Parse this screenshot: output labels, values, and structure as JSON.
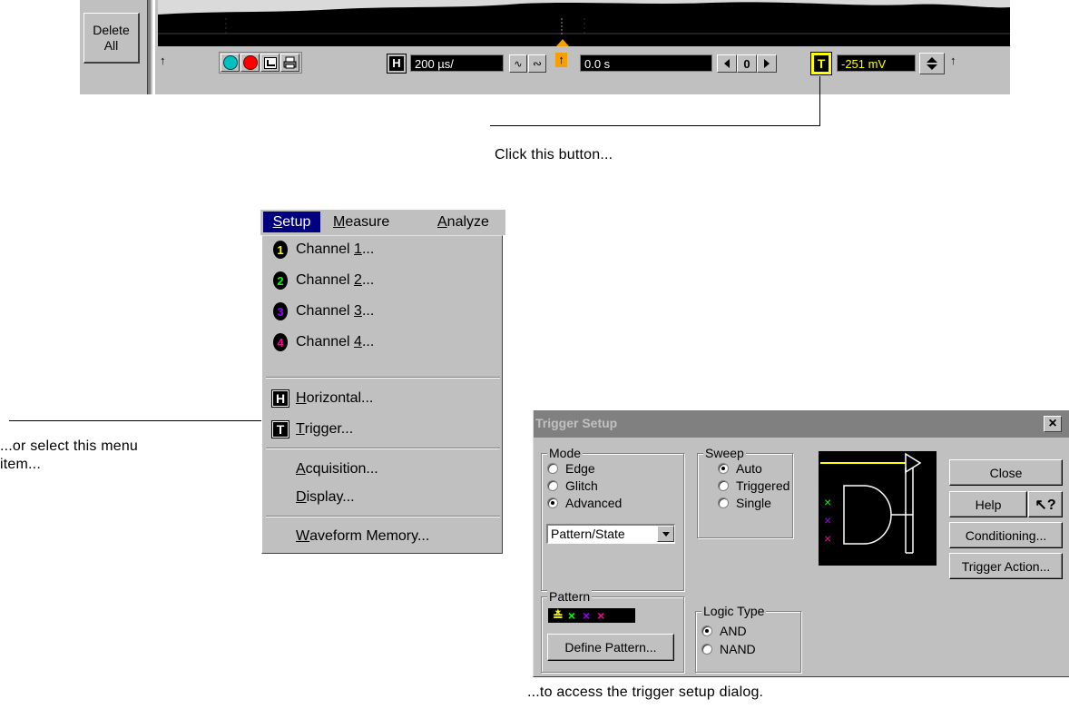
{
  "toolbar": {
    "delete_all_label_line1": "Delete",
    "delete_all_label_line2": "All",
    "horizontal_badge": "H",
    "timebase_value": "200 µs/",
    "time_offset_value": "0.0 s",
    "nav_zero": "0",
    "trigger_badge": "T",
    "trigger_level_value": "-251 mV",
    "accent_orange": "#f5a000",
    "trigger_yellow": "#ffff00"
  },
  "callouts": {
    "button_hint": "Click this button...",
    "menu_hint_line1": "...or select this menu",
    "menu_hint_line2": "item...",
    "dialog_hint": "...to access the trigger setup dialog."
  },
  "menubar": {
    "items": [
      {
        "label": "Setup",
        "mnemonic": "S",
        "rest": "etup",
        "active": true
      },
      {
        "label": "Measure",
        "mnemonic": "M",
        "rest": "easure",
        "active": false
      },
      {
        "label": "Analyze",
        "mnemonic": "A",
        "rest": "nalyze",
        "active": false
      }
    ]
  },
  "setup_menu": {
    "channels": [
      {
        "num": "1",
        "pre": "Channel ",
        "mn": "1",
        "post": "...",
        "color": "#ffff00"
      },
      {
        "num": "2",
        "pre": "Channel ",
        "mn": "2",
        "post": "...",
        "color": "#00ff00"
      },
      {
        "num": "3",
        "pre": "Channel ",
        "mn": "3",
        "post": "...",
        "color": "#9900ff"
      },
      {
        "num": "4",
        "pre": "Channel ",
        "mn": "4",
        "post": "...",
        "color": "#ff0099"
      }
    ],
    "horizontal": {
      "badge": "H",
      "mn": "H",
      "rest": "orizontal..."
    },
    "trigger": {
      "badge": "T",
      "mn": "T",
      "rest": "rigger..."
    },
    "acquisition": {
      "mn": "A",
      "rest": "cquisition..."
    },
    "display": {
      "mn": "D",
      "rest": "isplay..."
    },
    "waveform_memory": {
      "mn": "W",
      "rest": "aveform Memory..."
    }
  },
  "dialog": {
    "title": "Trigger Setup",
    "close_x": "×",
    "mode": {
      "title": "Mode",
      "options": [
        "Edge",
        "Glitch",
        "Advanced"
      ],
      "selected": "Advanced",
      "dropdown_value": "Pattern/State"
    },
    "sweep": {
      "title": "Sweep",
      "options": [
        "Auto",
        "Triggered",
        "Single"
      ],
      "selected": "Auto"
    },
    "pattern": {
      "title": "Pattern",
      "define_button": "Define Pattern..."
    },
    "logic_type": {
      "title": "Logic Type",
      "options": [
        "AND",
        "NAND"
      ],
      "selected": "AND"
    },
    "buttons": {
      "close": "Close",
      "help": "Help",
      "conditioning": "Conditioning...",
      "trigger_action": "Trigger Action..."
    },
    "colors": {
      "title_bar": "#808080",
      "ch1": "#ffff00",
      "ch2": "#00ff00",
      "ch3": "#9900ff",
      "ch4": "#ff0099"
    }
  }
}
